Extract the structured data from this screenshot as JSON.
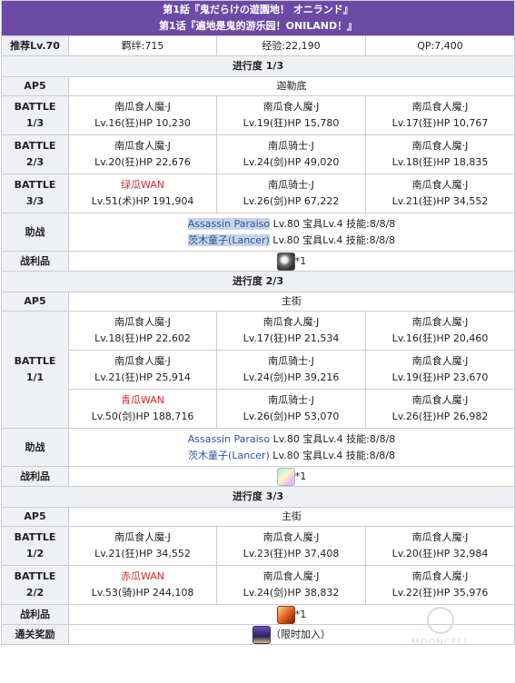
{
  "header": {
    "title_jp": "第1話『鬼だらけの遊園地！ オニランド』",
    "title_cn": "第1话『遍地是鬼的游乐园！ONILAND！』"
  },
  "info": {
    "recommend": "推荐Lv.70",
    "bond": "羁绊:715",
    "exp": "经验:22,190",
    "qp": "QP:7,400"
  },
  "labels": {
    "support": "助战",
    "loot": "战利品",
    "clear_reward": "通关奖励"
  },
  "sections": [
    {
      "progress": "进行度 1/3",
      "ap": "AP5",
      "location": "迦勒底",
      "battles": [
        {
          "label1": "BATTLE",
          "label2": "1/3",
          "enemies": [
            [
              {
                "name": "南瓜食人魔·J",
                "stats": "Lv.16(狂)HP 10,230"
              },
              {
                "name": "南瓜食人魔·J",
                "stats": "Lv.19(狂)HP 15,780"
              },
              {
                "name": "南瓜食人魔·J",
                "stats": "Lv.17(狂)HP 10,767"
              }
            ]
          ]
        },
        {
          "label1": "BATTLE",
          "label2": "2/3",
          "enemies": [
            [
              {
                "name": "南瓜食人魔·J",
                "stats": "Lv.20(狂)HP 22,676"
              },
              {
                "name": "南瓜骑士·J",
                "stats": "Lv.24(剑)HP 49,020"
              },
              {
                "name": "南瓜食人魔·J",
                "stats": "Lv.18(狂)HP 18,835"
              }
            ]
          ]
        },
        {
          "label1": "BATTLE",
          "label2": "3/3",
          "enemies": [
            [
              {
                "name": "绿瓜WAN",
                "stats": "Lv.51(术)HP 191,904",
                "red": true
              },
              {
                "name": "南瓜骑士·J",
                "stats": "Lv.26(剑)HP 67,222"
              },
              {
                "name": "南瓜食人魔·J",
                "stats": "Lv.21(狂)HP 34,552"
              }
            ]
          ]
        }
      ],
      "support": [
        {
          "name": "Assassin Paraiso",
          "detail": " Lv.80 宝具Lv.4 技能:8/8/8"
        },
        {
          "name": "茨木童子(Lancer)",
          "detail": " Lv.80 宝具Lv.4 技能:8/8/8"
        }
      ],
      "loot_qty": "*1"
    },
    {
      "progress": "进行度 2/3",
      "ap": "AP5",
      "location": "主街",
      "battles": [
        {
          "label1": "BATTLE",
          "label2": "1/1",
          "enemies": [
            [
              {
                "name": "南瓜食人魔·J",
                "stats": "Lv.18(狂)HP 22,602"
              },
              {
                "name": "南瓜食人魔·J",
                "stats": "Lv.17(狂)HP 21,534"
              },
              {
                "name": "南瓜食人魔·J",
                "stats": "Lv.16(狂)HP 20,460"
              }
            ],
            [
              {
                "name": "南瓜食人魔·J",
                "stats": "Lv.21(狂)HP 25,914"
              },
              {
                "name": "南瓜骑士·J",
                "stats": "Lv.24(剑)HP 39,216"
              },
              {
                "name": "南瓜食人魔·J",
                "stats": "Lv.19(狂)HP 23,670"
              }
            ],
            [
              {
                "name": "青瓜WAN",
                "stats": "Lv.50(剑)HP 188,716",
                "red": true
              },
              {
                "name": "南瓜骑士·J",
                "stats": "Lv.26(剑)HP 53,070"
              },
              {
                "name": "南瓜食人魔·J",
                "stats": "Lv.26(狂)HP 26,982"
              }
            ]
          ]
        }
      ],
      "support": [
        {
          "name": "Assassin Paraiso",
          "detail": " Lv.80 宝具Lv.4 技能:8/8/8"
        },
        {
          "name": "茨木童子(Lancer)",
          "detail": " Lv.80 宝具Lv.4 技能:8/8/8"
        }
      ],
      "loot_qty": "*1"
    },
    {
      "progress": "进行度 3/3",
      "ap": "AP5",
      "location": "主街",
      "battles": [
        {
          "label1": "BATTLE",
          "label2": "1/2",
          "enemies": [
            [
              {
                "name": "南瓜食人魔·J",
                "stats": "Lv.21(狂)HP 34,552"
              },
              {
                "name": "南瓜食人魔·J",
                "stats": "Lv.23(狂)HP 37,408"
              },
              {
                "name": "南瓜食人魔·J",
                "stats": "Lv.20(狂)HP 32,984"
              }
            ]
          ]
        },
        {
          "label1": "BATTLE",
          "label2": "2/2",
          "enemies": [
            [
              {
                "name": "赤瓜WAN",
                "stats": "Lv.53(骑)HP 244,108",
                "red": true
              },
              {
                "name": "南瓜食人魔·J",
                "stats": "Lv.24(剑)HP 38,832"
              },
              {
                "name": "南瓜食人魔·J",
                "stats": "Lv.22(狂)HP 35,976"
              }
            ]
          ]
        }
      ],
      "loot_qty": "*1",
      "clear_reward": "（限时加入）"
    }
  ],
  "watermark": "MOONCELL",
  "icons": {
    "loot1": "gray-crystal-icon",
    "loot2": "prism-crystal-icon",
    "loot3": "ember-feather-icon",
    "reward": "servant-card-icon"
  }
}
